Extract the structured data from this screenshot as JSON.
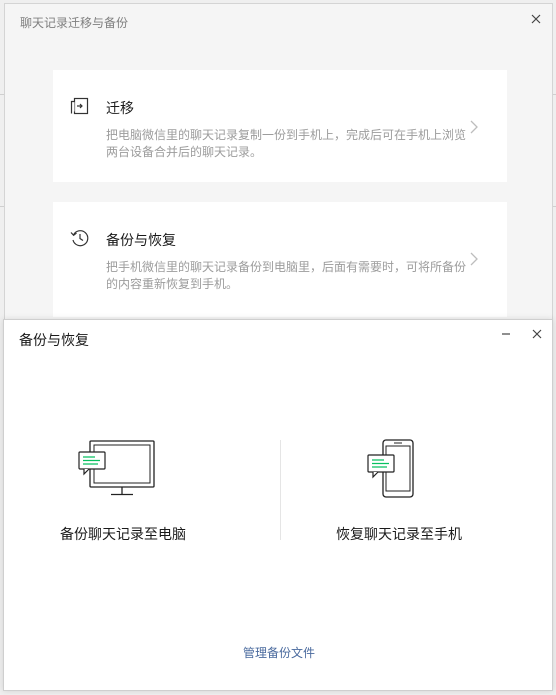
{
  "migrate_dialog": {
    "title": "聊天记录迁移与备份",
    "close_icon": "close-icon",
    "cards": [
      {
        "icon": "migrate-icon",
        "title": "迁移",
        "desc": "把电脑微信里的聊天记录复制一份到手机上，完成后可在手机上浏览两台设备合并后的聊天记录。",
        "chevron": "chevron-right-icon"
      },
      {
        "icon": "history-icon",
        "title": "备份与恢复",
        "desc": "把手机微信里的聊天记录备份到电脑里，后面有需要时，可将所备份的内容重新恢复到手机。",
        "chevron": "chevron-right-icon"
      }
    ]
  },
  "backup_dialog": {
    "title": "备份与恢复",
    "minimize_icon": "minimize-icon",
    "close_icon": "close-icon",
    "options": [
      {
        "icon": "computer-chat-icon",
        "label": "备份聊天记录至电脑"
      },
      {
        "icon": "phone-chat-icon",
        "label": "恢复聊天记录至手机"
      }
    ],
    "manage_link": "管理备份文件"
  },
  "colors": {
    "accent_green": "#07c160",
    "link_blue": "#4a6a9e",
    "desc_gray": "#9c9c9c"
  }
}
